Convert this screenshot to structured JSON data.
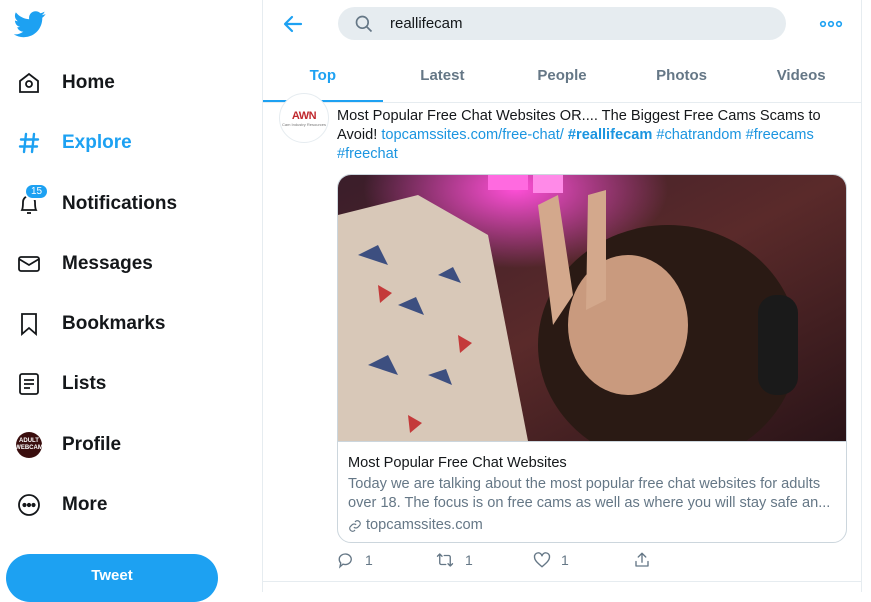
{
  "sidebar": {
    "items": [
      {
        "label": "Home",
        "icon": "home-icon"
      },
      {
        "label": "Explore",
        "icon": "hashtag-icon"
      },
      {
        "label": "Notifications",
        "icon": "bell-icon",
        "badge": "15"
      },
      {
        "label": "Messages",
        "icon": "envelope-icon"
      },
      {
        "label": "Bookmarks",
        "icon": "bookmark-icon"
      },
      {
        "label": "Lists",
        "icon": "list-icon"
      },
      {
        "label": "Profile",
        "icon": "avatar"
      },
      {
        "label": "More",
        "icon": "more-circle-icon"
      }
    ],
    "avatar_text": "ADULT WEBCAM",
    "tweet_button": "Tweet"
  },
  "search": {
    "value": "reallifecam"
  },
  "tabs": [
    {
      "label": "Top"
    },
    {
      "label": "Latest"
    },
    {
      "label": "People"
    },
    {
      "label": "Photos"
    },
    {
      "label": "Videos"
    }
  ],
  "tweet": {
    "avatar": {
      "logo": "AWN",
      "logo_accent": "N",
      "tagline": "Cam Industry Resources"
    },
    "text": "Most Popular Free Chat Websites OR.... The Biggest Free Cams Scams to Avoid!",
    "link": "topcamssites.com/free-chat/",
    "hashtags": [
      "#reallifecam",
      "#chatrandom",
      "#freecams",
      "#freechat"
    ],
    "card": {
      "title": "Most Popular Free Chat Websites",
      "description": "Today we are talking about the most popular free chat websites for adults over 18. The focus is on free cams as well as where you will stay safe an...",
      "domain": "topcamssites.com"
    },
    "actions": {
      "replies": "1",
      "retweets": "1",
      "likes": "1"
    }
  },
  "colors": {
    "accent": "#1da1f2",
    "text": "#14171a",
    "muted": "#657786",
    "border": "#e6ecf0"
  }
}
